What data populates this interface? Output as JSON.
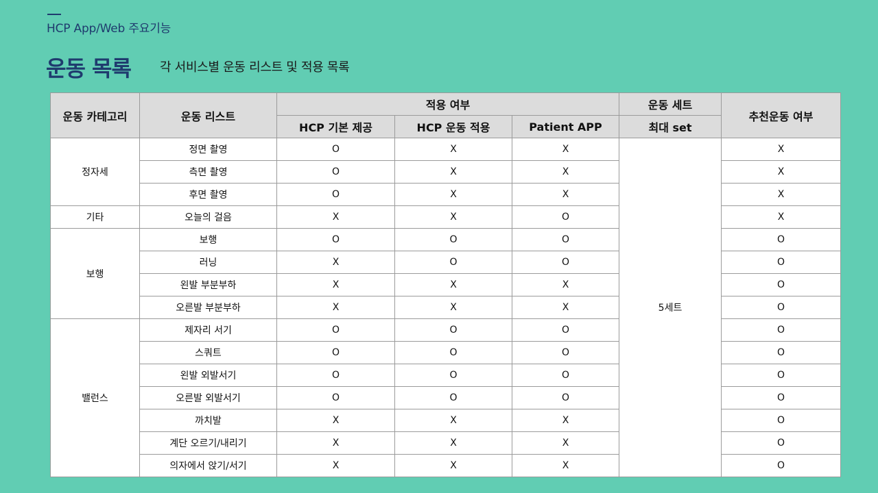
{
  "header": {
    "label": "HCP App/Web 주요기능"
  },
  "page": {
    "title": "운동 목록",
    "subtitle": "각 서비스별 운동 리스트 및 적용 목록"
  },
  "colors": {
    "background": "#61cdb3",
    "title": "#1f3b6e",
    "header_cell": "#dcdcdc"
  },
  "table": {
    "headers": {
      "category": "운동 카테고리",
      "exercise": "운동 리스트",
      "apply_group": "적용 여부",
      "hcp_basic": "HCP 기본 제공",
      "hcp_exercise": "HCP 운동 적용",
      "patient_app": "Patient APP",
      "set_group": "운동 세트",
      "max_set": "최대 set",
      "recommended": "추천운동 여부"
    },
    "max_set_value": "5세트",
    "categories": [
      {
        "name": "정자세",
        "rowspan": 3
      },
      {
        "name": "기타",
        "rowspan": 1
      },
      {
        "name": "보행",
        "rowspan": 4
      },
      {
        "name": "밸런스",
        "rowspan": 7
      }
    ],
    "rows": [
      {
        "exercise": "정면 촬영",
        "hcp_basic": "O",
        "hcp_exercise": "X",
        "patient_app": "X",
        "recommended": "X"
      },
      {
        "exercise": "측면 촬영",
        "hcp_basic": "O",
        "hcp_exercise": "X",
        "patient_app": "X",
        "recommended": "X"
      },
      {
        "exercise": "후면 촬영",
        "hcp_basic": "O",
        "hcp_exercise": "X",
        "patient_app": "X",
        "recommended": "X"
      },
      {
        "exercise": "오늘의 걸음",
        "hcp_basic": "X",
        "hcp_exercise": "X",
        "patient_app": "O",
        "recommended": "X"
      },
      {
        "exercise": "보행",
        "hcp_basic": "O",
        "hcp_exercise": "O",
        "patient_app": "O",
        "recommended": "O"
      },
      {
        "exercise": "러닝",
        "hcp_basic": "X",
        "hcp_exercise": "O",
        "patient_app": "O",
        "recommended": "O"
      },
      {
        "exercise": "왼발 부분부하",
        "hcp_basic": "X",
        "hcp_exercise": "X",
        "patient_app": "X",
        "recommended": "O"
      },
      {
        "exercise": "오른발 부분부하",
        "hcp_basic": "X",
        "hcp_exercise": "X",
        "patient_app": "X",
        "recommended": "O"
      },
      {
        "exercise": "제자리 서기",
        "hcp_basic": "O",
        "hcp_exercise": "O",
        "patient_app": "O",
        "recommended": "O"
      },
      {
        "exercise": "스쿼트",
        "hcp_basic": "O",
        "hcp_exercise": "O",
        "patient_app": "O",
        "recommended": "O"
      },
      {
        "exercise": "왼발 외발서기",
        "hcp_basic": "O",
        "hcp_exercise": "O",
        "patient_app": "O",
        "recommended": "O"
      },
      {
        "exercise": "오른발 외발서기",
        "hcp_basic": "O",
        "hcp_exercise": "O",
        "patient_app": "O",
        "recommended": "O"
      },
      {
        "exercise": "까치발",
        "hcp_basic": "X",
        "hcp_exercise": "X",
        "patient_app": "X",
        "recommended": "O"
      },
      {
        "exercise": "계단 오르기/내리기",
        "hcp_basic": "X",
        "hcp_exercise": "X",
        "patient_app": "X",
        "recommended": "O"
      },
      {
        "exercise": "의자에서 앉기/서기",
        "hcp_basic": "X",
        "hcp_exercise": "X",
        "patient_app": "X",
        "recommended": "O"
      }
    ]
  }
}
